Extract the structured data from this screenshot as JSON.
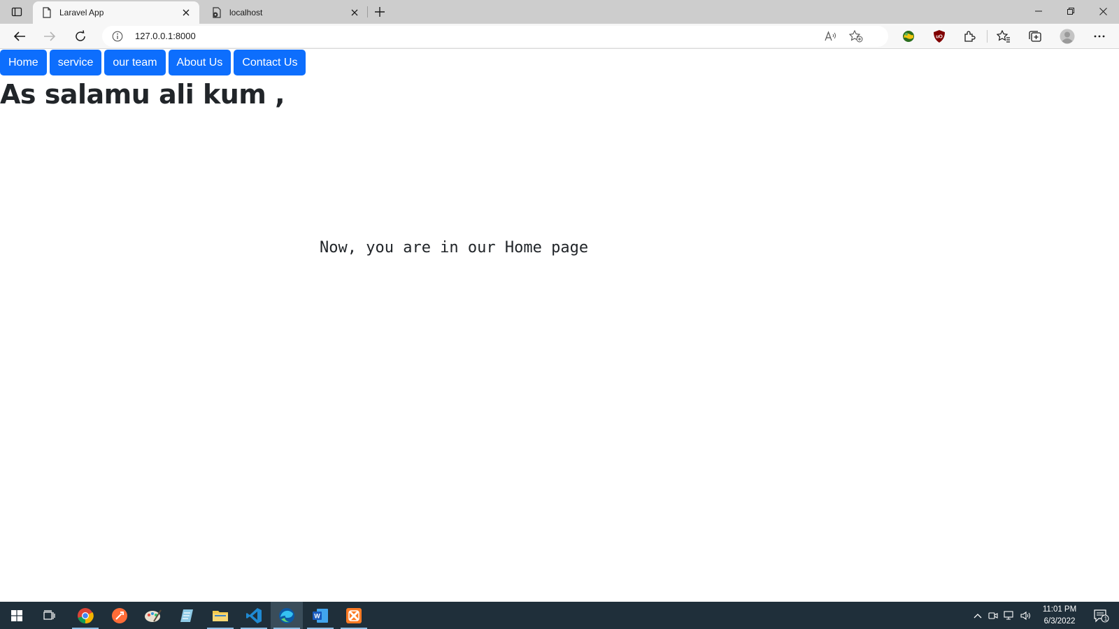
{
  "browser": {
    "tabs": [
      {
        "title": "Laravel App",
        "active": true,
        "icon": "page-icon"
      },
      {
        "title": "localhost",
        "active": false,
        "icon": "page-lock-icon"
      }
    ],
    "address": "127.0.0.1:8000",
    "toolbar_icons": [
      "back-icon",
      "forward-icon",
      "refresh-icon",
      "info-icon",
      "read-aloud-icon",
      "add-favorite-icon",
      "extension-globe-icon",
      "ublock-icon",
      "extensions-icon",
      "favorites-icon",
      "collections-icon",
      "profile-icon",
      "more-icon"
    ],
    "window_controls": [
      "minimize-icon",
      "restore-icon",
      "close-icon"
    ]
  },
  "page": {
    "nav": [
      "Home",
      "service",
      "our team",
      "About Us",
      "Contact Us"
    ],
    "greeting": "As salamu ali kum ,",
    "message": "Now, you are in our Home page"
  },
  "taskbar": {
    "apps": [
      "chrome",
      "postman",
      "paint",
      "notepad",
      "file-explorer",
      "vscode",
      "edge",
      "word",
      "xampp"
    ],
    "active_app": "edge",
    "time": "11:01 PM",
    "date": "6/3/2022",
    "notification_count": "1"
  },
  "colors": {
    "nav_button": "#0d6efd",
    "taskbar": "#1f2f3a",
    "tabstrip": "#cdcdcd",
    "toolbar": "#f7f7f7"
  }
}
